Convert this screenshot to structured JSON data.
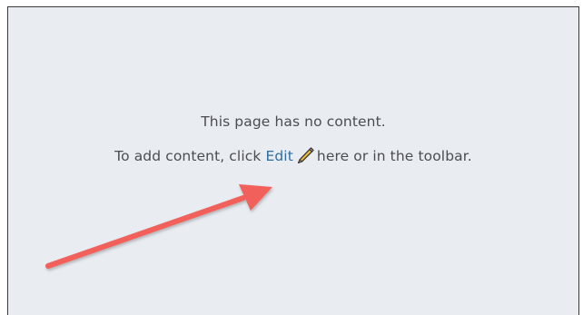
{
  "empty_state": {
    "message": "This page has no content.",
    "prefix": "To add content, click ",
    "edit_label": "Edit",
    "suffix": "here or in the toolbar."
  },
  "icons": {
    "edit": "pencil-icon",
    "annotation": "arrow-annotation"
  },
  "colors": {
    "panel_background": "#e9ecf1",
    "text": "#4a4d52",
    "link": "#2f6e9e",
    "annotation_arrow": "#f1605a"
  }
}
